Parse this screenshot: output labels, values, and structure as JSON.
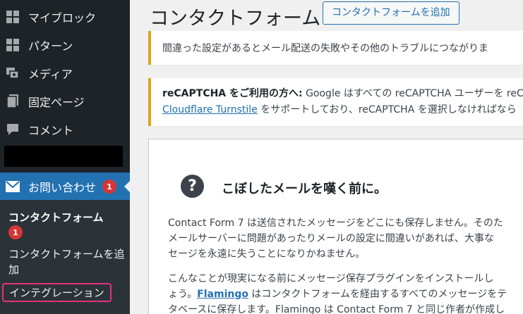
{
  "sidebar": {
    "items": [
      {
        "label": "マイブロック",
        "icon": "blocks-grid-icon"
      },
      {
        "label": "パターン",
        "icon": "patterns-grid-icon"
      },
      {
        "label": "メディア",
        "icon": "media-icon"
      },
      {
        "label": "固定ページ",
        "icon": "pages-icon"
      },
      {
        "label": "コメント",
        "icon": "comment-icon"
      }
    ],
    "current": {
      "label": "お問い合わせ",
      "icon": "mail-icon",
      "badge": "1"
    },
    "submenu": {
      "current_label": "コンタクトフォーム",
      "current_badge": "1",
      "add_label": "コンタクトフォームを追加",
      "integration_label": "インテグレーション"
    }
  },
  "main": {
    "title": "コンタクトフォーム",
    "add_button": "コンタクトフォームを追加",
    "notice1": "間違った設定があるとメール配送の失敗やその他のトラブルにつながりま",
    "notice2": {
      "bold": "reCAPTCHA をご利用の方へ:",
      "text": " Google はすべての reCAPTCHA ユーザーを reC",
      "link": "Cloudflare Turnstile",
      "after_link": " をサポートしており、reCAPTCHA を選択しなければなら"
    },
    "card": {
      "title": "こぼしたメールを嘆く前に。",
      "p1": [
        "Contact Form 7 は送信されたメッセージをどこにも保存しません。そのた",
        "メールサーバーに問題があったりメールの設定に間違いがあれば、大事な",
        "セージを永遠に失うことになりかねません。"
      ],
      "p2_line1": "こんなことが現実になる前にメッセージ保存プラグインをインストールし",
      "p2_line2_pre": "ょう。",
      "p2_link": "Flamingo",
      "p2_line2_post": " はコンタクトフォームを経由するすべてのメッセージをテ",
      "p2_line3": "タベースに保存します。Flamingo は Contact Form 7 と同じ作者が作成し"
    }
  },
  "colors": {
    "sidebar_bg": "#1d2327",
    "accent": "#2271b1",
    "badge": "#d63638",
    "notice_border": "#dba617",
    "highlight": "#e5317d"
  }
}
